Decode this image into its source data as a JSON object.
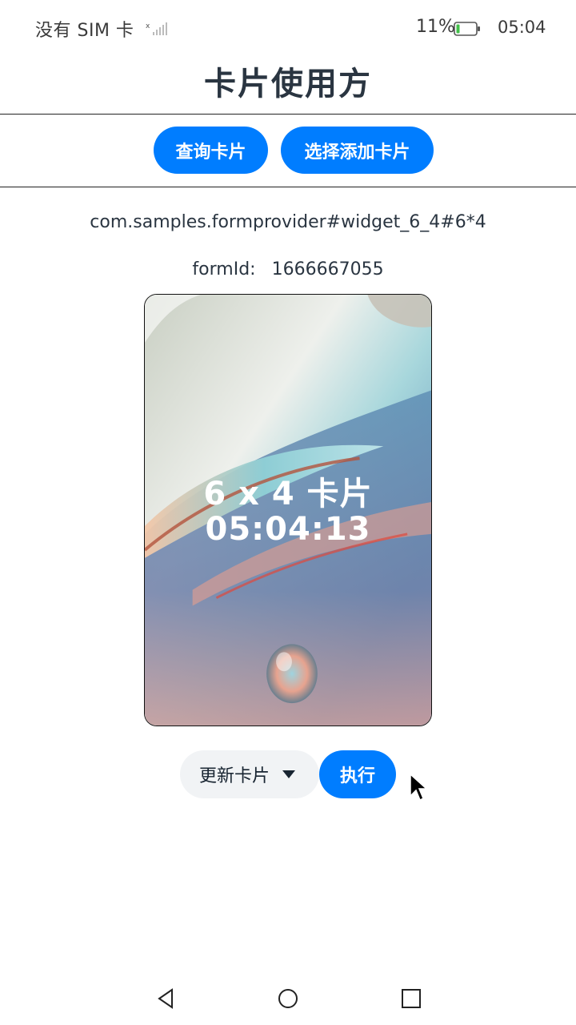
{
  "status_bar": {
    "carrier": "没有 SIM 卡",
    "battery": "11%",
    "time": "05:04",
    "icons": [
      "signal-icon",
      "battery-icon"
    ]
  },
  "page": {
    "title": "卡片使用方"
  },
  "actions": {
    "query_label": "查询卡片",
    "add_label": "选择添加卡片"
  },
  "form_info": {
    "bundle_name": "com.samples.formprovider#widget_6_4#6*4",
    "form_id_label": "formId:",
    "form_id_value": "1666667055"
  },
  "card": {
    "title": "6 x 4 卡片",
    "time": "05:04:13"
  },
  "controls": {
    "select_value": "更新卡片",
    "exec_label": "执行"
  },
  "navigation": {
    "icons": [
      "back-icon",
      "home-icon",
      "recent-apps-icon"
    ]
  },
  "colors": {
    "accent": "#007dff",
    "title": "#2a3541",
    "select_bg": "#f1f3f5"
  }
}
